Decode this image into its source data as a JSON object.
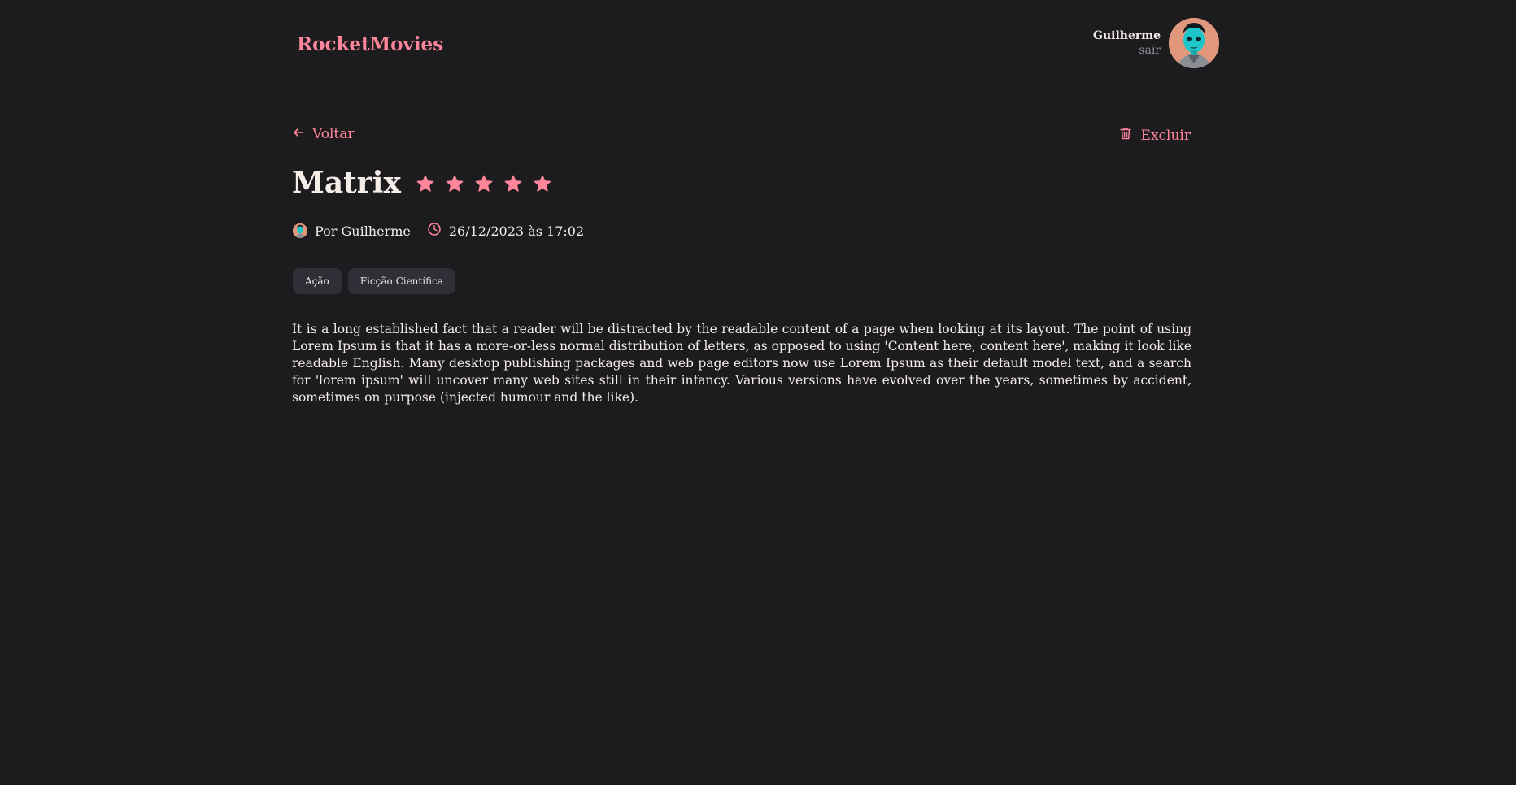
{
  "header": {
    "brand": "RocketMovies",
    "user_name": "Guilherme",
    "logout_label": "sair"
  },
  "nav": {
    "back_label": "Voltar",
    "delete_label": "Excluir"
  },
  "movie": {
    "title": "Matrix",
    "rating": 5,
    "rating_max": 5,
    "author": "Por Guilherme",
    "created_at": "26/12/2023 às 17:02",
    "tags": [
      "Ação",
      "Ficção Científica"
    ],
    "description": "It is a long established fact that a reader will be distracted by the readable content of a page when looking at its layout. The point of using Lorem Ipsum is that it has a more-or-less normal distribution of letters, as opposed to using 'Content here, content here', making it look like readable English. Many desktop publishing packages and web page editors now use Lorem Ipsum as their default model text, and a search for 'lorem ipsum' will uncover many web sites still in their infancy. Various versions have evolved over the years, sometimes by accident, sometimes on purpose (injected humour and the like)."
  },
  "colors": {
    "background": "#1c1b1e",
    "accent": "#ff859b",
    "text": "#f4ede8",
    "muted": "#948f99",
    "tag_bg": "#312e38",
    "divider": "#3e3b47"
  },
  "icons": {
    "back": "arrow-left-icon",
    "delete": "trash-icon",
    "star": "star-icon",
    "clock": "clock-icon"
  }
}
